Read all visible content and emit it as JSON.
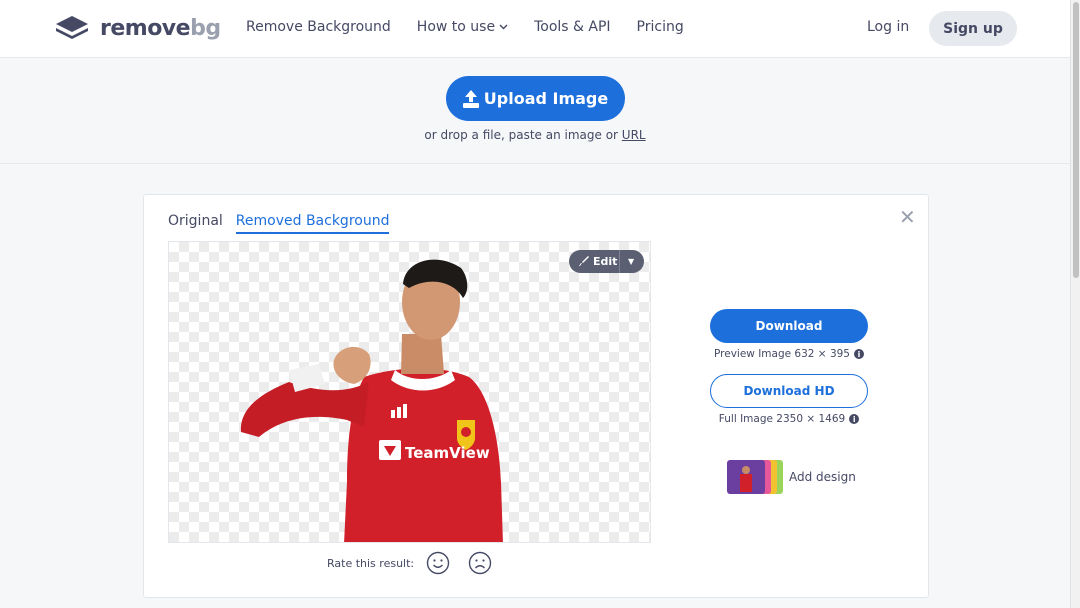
{
  "header": {
    "logo": {
      "word_remove": "remove",
      "word_bg": "bg"
    },
    "nav": [
      {
        "label": "Remove Background"
      },
      {
        "label": "How to use"
      },
      {
        "label": "Tools & API"
      },
      {
        "label": "Pricing"
      }
    ],
    "login_label": "Log in",
    "signup_label": "Sign up"
  },
  "upload": {
    "button_label": "Upload Image",
    "sub_prefix": "or drop a file, paste an image or",
    "url_label": "URL"
  },
  "result": {
    "tabs": [
      {
        "label": "Original",
        "active": false
      },
      {
        "label": "Removed Background",
        "active": true
      }
    ],
    "edit_label": "Edit",
    "rate_label": "Rate this result:",
    "download_label": "Download",
    "preview_info": "Preview Image 632 × 395",
    "download_hd_label": "Download HD",
    "full_info": "Full Image 2350 × 1469",
    "add_design_label": "Add design"
  },
  "colors": {
    "accent": "#1d6fdc",
    "text": "#454964",
    "jersey_red": "#d2202a"
  }
}
